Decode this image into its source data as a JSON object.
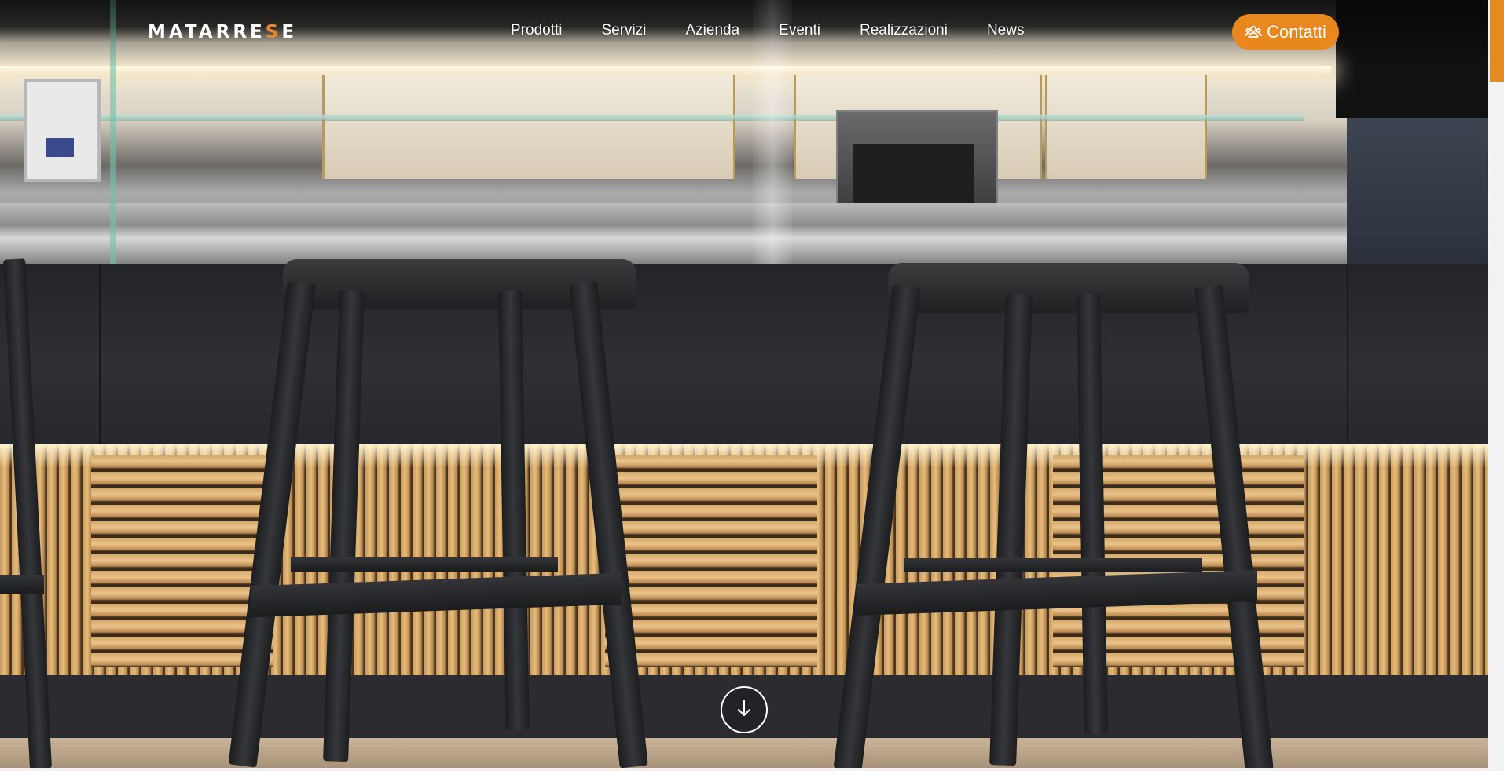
{
  "header": {
    "logo": {
      "main": "MATARRE",
      "accent": "S",
      "tail": "E"
    },
    "nav": [
      {
        "label": "Prodotti"
      },
      {
        "label": "Servizi"
      },
      {
        "label": "Azienda"
      },
      {
        "label": "Eventi"
      },
      {
        "label": "Realizzazioni"
      },
      {
        "label": "News"
      }
    ],
    "contact_button": {
      "label": "Contatti",
      "icon": "users-icon"
    }
  },
  "hero": {
    "scroll_icon": "arrow-down-icon"
  },
  "colors": {
    "accent": "#e8871e",
    "text": "#ffffff"
  }
}
